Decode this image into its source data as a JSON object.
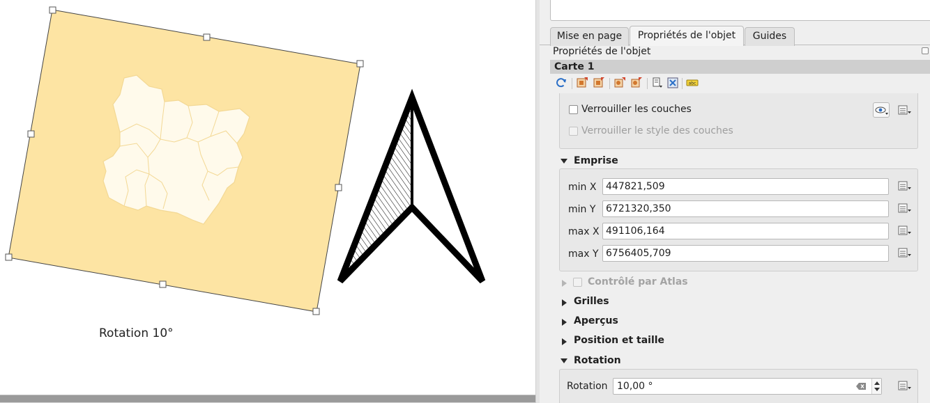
{
  "canvas": {
    "rotation_label": "Rotation 10°",
    "map_item": {
      "rotation_degrees": 10,
      "background_color": "#fde4a3",
      "region_fill": "#fffaeb",
      "region_border": "#f5d99a"
    },
    "north_arrow": {
      "color": "#000000"
    }
  },
  "panel": {
    "tabs": [
      {
        "label": "Mise en page",
        "active": false
      },
      {
        "label": "Propriétés de l'objet",
        "active": true
      },
      {
        "label": "Guides",
        "active": false
      }
    ],
    "title": "Propriétés de l'objet",
    "item_name": "Carte 1",
    "toolbar_icons": [
      "refresh-icon",
      "set-extent-from-canvas-icon",
      "view-extent-in-canvas-icon",
      "set-scale-from-canvas-icon",
      "view-scale-in-canvas-icon",
      "bookmark-extent-icon",
      "interactive-extent-icon",
      "label-settings-icon"
    ],
    "lock_layers": {
      "label": "Verrouiller les couches",
      "checked": false
    },
    "lock_styles": {
      "label": "Verrouiller le style des couches",
      "checked": false,
      "disabled": true
    },
    "extent": {
      "title": "Emprise",
      "fields": [
        {
          "label": "min X",
          "value": "447821,509"
        },
        {
          "label": "min Y",
          "value": "6721320,350"
        },
        {
          "label": "max X",
          "value": "491106,164"
        },
        {
          "label": "max Y",
          "value": "6756405,709"
        }
      ]
    },
    "atlas": {
      "label": "Contrôlé par Atlas",
      "disabled": true
    },
    "sections": [
      {
        "label": "Grilles",
        "expanded": false
      },
      {
        "label": "Aperçus",
        "expanded": false
      },
      {
        "label": "Position et taille",
        "expanded": false
      }
    ],
    "rotation": {
      "title": "Rotation",
      "label": "Rotation",
      "value": "10,00 °"
    }
  }
}
